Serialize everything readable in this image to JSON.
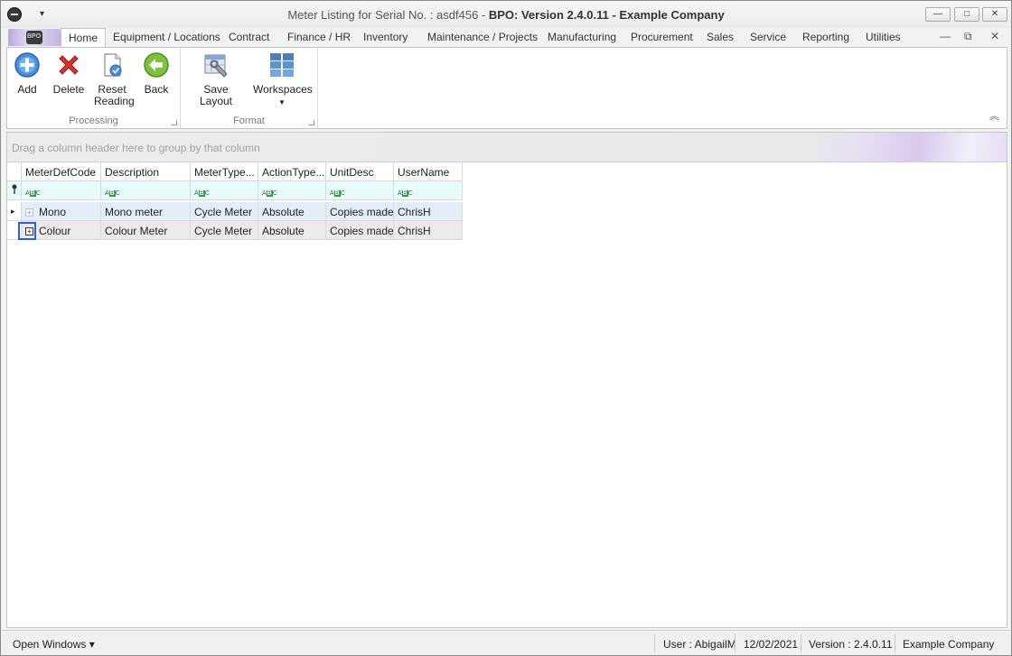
{
  "window": {
    "title_prefix": "Meter Listing for Serial No. : asdf456 - ",
    "title_brand": "BPO: Version 2.4.0.11 - Example Company",
    "qat_arrow": "▾",
    "minimize": "—",
    "maximize": "□",
    "close": "✕"
  },
  "tabs": [
    "Home",
    "Equipment / Locations",
    "Contract",
    "Finance / HR",
    "Inventory",
    "Maintenance / Projects",
    "Manufacturing",
    "Procurement",
    "Sales",
    "Service",
    "Reporting",
    "Utilities"
  ],
  "mdi": {
    "minimize": "—",
    "restore": "⧉",
    "close": "✕"
  },
  "ribbon": {
    "groups": {
      "processing": "Processing",
      "format": "Format"
    },
    "buttons": {
      "add": "Add",
      "delete": "Delete",
      "reset_line1": "Reset",
      "reset_line2": "Reading",
      "back": "Back",
      "save_layout": "Save Layout",
      "workspaces": "Workspaces"
    },
    "collapse": "︽"
  },
  "grid": {
    "group_hint": "Drag a column header here to group by that column",
    "columns": [
      "MeterDefCode",
      "Description",
      "MeterType...",
      "ActionType...",
      "UnitDesc",
      "UserName"
    ],
    "rows": [
      [
        "Mono",
        "Mono meter",
        "Cycle Meter",
        "Absolute",
        "Copies made",
        "ChrisH"
      ],
      [
        "Colour",
        "Colour Meter",
        "Cycle Meter",
        "Absolute",
        "Copies made",
        "ChrisH"
      ]
    ],
    "row_pointer": "▸",
    "expand_glyph": "+"
  },
  "statusbar": {
    "open_windows": "Open Windows ▾",
    "user": "User : AbigailM",
    "date": "12/02/2021",
    "version": "Version : 2.4.0.11",
    "company": "Example Company"
  },
  "colors": {
    "accent": "#2b5fd9",
    "filter_row": "#e6fbfa",
    "selected_row": "#e4ecfa"
  }
}
